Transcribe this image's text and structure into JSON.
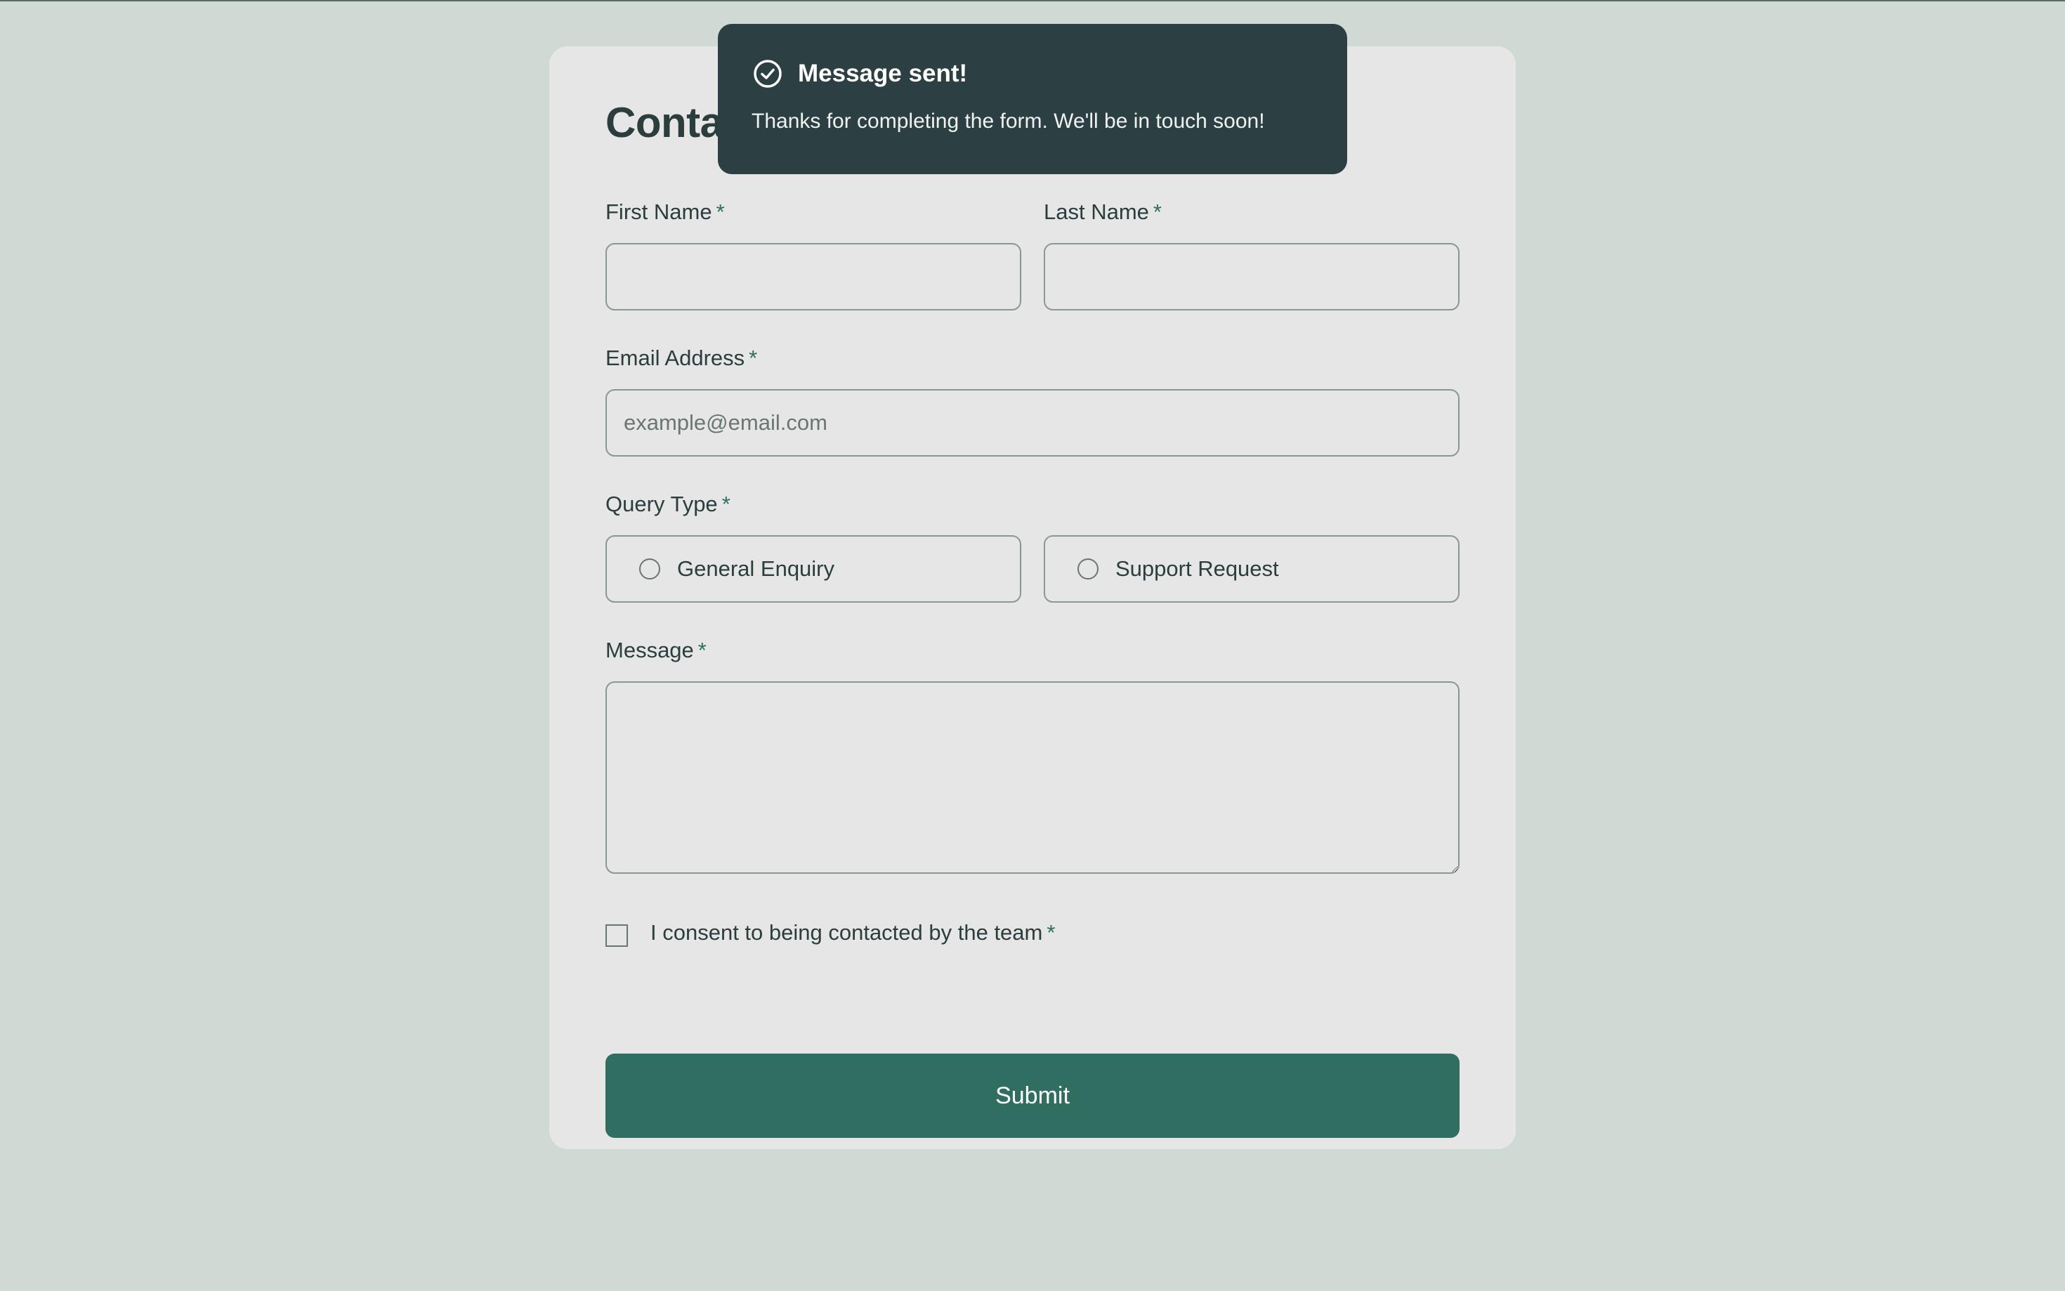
{
  "form": {
    "title": "Contact Us",
    "first_name": {
      "label": "First Name",
      "required_mark": "*",
      "value": ""
    },
    "last_name": {
      "label": "Last Name",
      "required_mark": "*",
      "value": ""
    },
    "email": {
      "label": "Email Address",
      "required_mark": "*",
      "value": "",
      "placeholder": "example@email.com"
    },
    "query_type": {
      "label": "Query Type",
      "required_mark": "*",
      "options": [
        "General Enquiry",
        "Support Request"
      ],
      "selected": null
    },
    "message": {
      "label": "Message",
      "required_mark": "*",
      "value": ""
    },
    "consent": {
      "label": "I consent to being contacted by the team",
      "required_mark": "*",
      "checked": false
    },
    "submit_label": "Submit"
  },
  "toast": {
    "icon": "check-circle-icon",
    "title": "Message sent!",
    "body": "Thanks for completing the form. We'll be in touch soon!"
  },
  "colors": {
    "page_background": "#cfdad4",
    "card_background": "#e6e6e6",
    "accent": "#2f6e60",
    "toast_background": "#2c3f42",
    "text": "#2b3d3d"
  }
}
